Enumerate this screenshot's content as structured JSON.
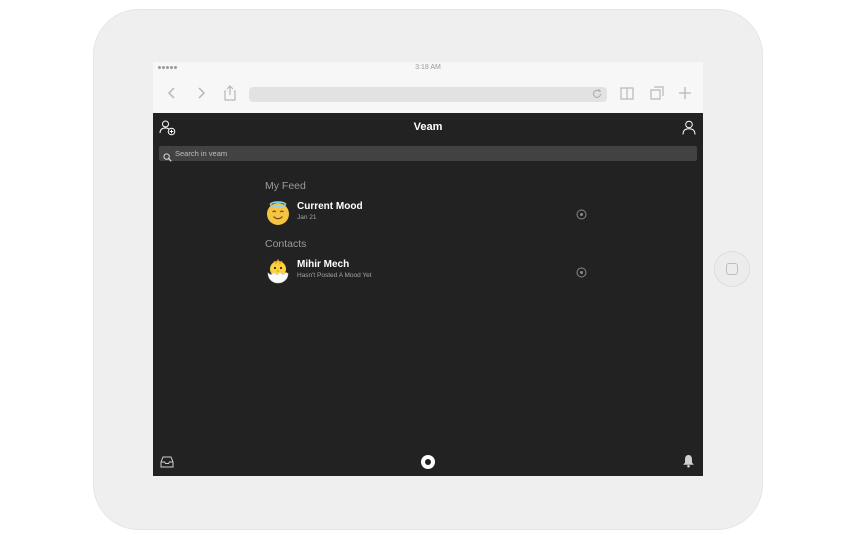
{
  "status_bar": {
    "time": "3:18 AM"
  },
  "browser": {
    "icons": [
      "chevron-left-icon",
      "chevron-right-icon",
      "share-icon",
      "reload-icon",
      "book-icon",
      "tabs-icon",
      "plus-icon"
    ]
  },
  "app": {
    "title": "Veam",
    "search": {
      "placeholder": "Search in veam"
    },
    "feed_section": "My Feed",
    "feed_items": [
      {
        "title": "Current Mood",
        "subtitle": "Jan 21",
        "avatar": "smiling-face-with-halo"
      }
    ],
    "contacts_section": "Contacts",
    "contacts": [
      {
        "title": "Mihir Mech",
        "subtitle": "Hasn't Posted A Mood Yet",
        "avatar": "hatching-chick"
      }
    ],
    "footer_icons": [
      "inbox-icon",
      "record-icon",
      "bell-icon"
    ]
  },
  "colors": {
    "app_background": "#222222",
    "search_background": "#424242",
    "section_title": "#9b9b9b",
    "device_frame": "#efefef"
  }
}
